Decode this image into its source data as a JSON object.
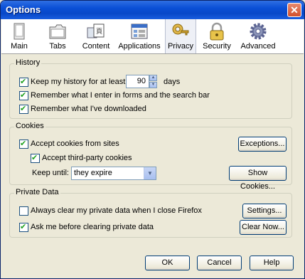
{
  "window": {
    "title": "Options",
    "close": "✕"
  },
  "tabs": [
    {
      "label": "Main",
      "icon": "main-icon"
    },
    {
      "label": "Tabs",
      "icon": "tabs-icon"
    },
    {
      "label": "Content",
      "icon": "content-icon"
    },
    {
      "label": "Applications",
      "icon": "applications-icon"
    },
    {
      "label": "Privacy",
      "icon": "privacy-icon",
      "selected": true
    },
    {
      "label": "Security",
      "icon": "security-icon"
    },
    {
      "label": "Advanced",
      "icon": "advanced-icon"
    }
  ],
  "history": {
    "title": "History",
    "keep_label": "Keep my history for at least",
    "keep_checked": true,
    "days_value": "90",
    "days_unit": "days",
    "forms_label": "Remember what I enter in forms and the search bar",
    "forms_checked": true,
    "downloads_label": "Remember what I've downloaded",
    "downloads_checked": true
  },
  "cookies": {
    "title": "Cookies",
    "accept_label": "Accept cookies from sites",
    "accept_checked": true,
    "exceptions_button": "Exceptions...",
    "third_party_label": "Accept third-party cookies",
    "third_party_checked": true,
    "keep_until_label": "Keep until:",
    "keep_until_value": "they expire",
    "show_cookies_button": "Show Cookies..."
  },
  "private_data": {
    "title": "Private Data",
    "always_clear_label": "Always clear my private data when I close Firefox",
    "always_clear_checked": false,
    "settings_button": "Settings...",
    "ask_label": "Ask me before clearing private data",
    "ask_checked": true,
    "clear_now_button": "Clear Now..."
  },
  "footer": {
    "ok": "OK",
    "cancel": "Cancel",
    "help": "Help"
  }
}
